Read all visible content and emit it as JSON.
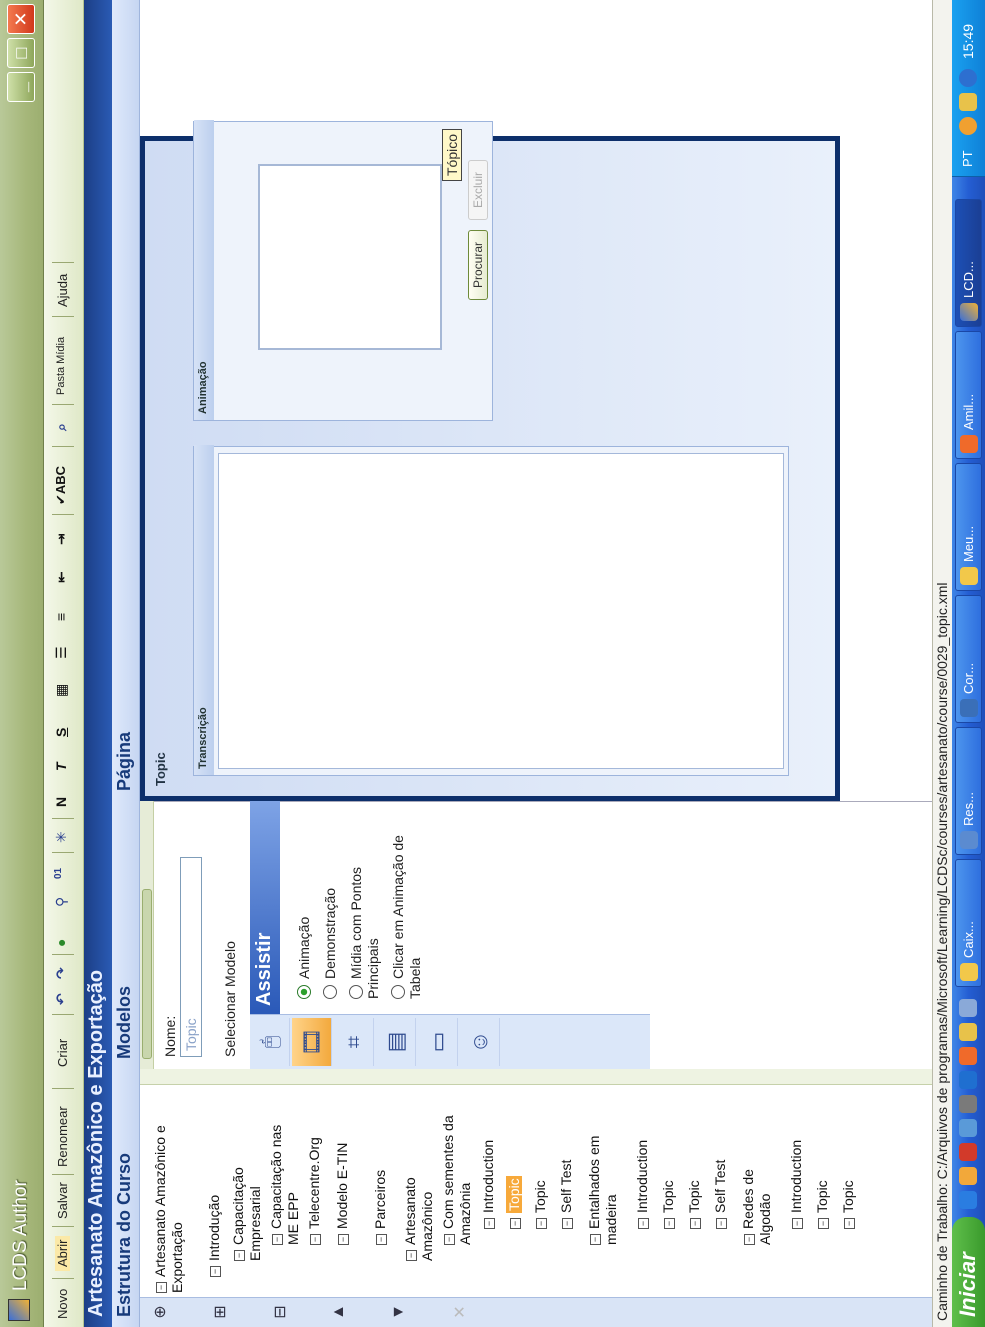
{
  "window": {
    "title": "LCDS Author"
  },
  "toolbar": {
    "novo": "Novo",
    "abrir": "Abrir",
    "salvar": "Salvar",
    "renomear": "Renomear",
    "criar": "Criar",
    "pasta_midia": "Pasta Mídia",
    "ajuda": "Ajuda",
    "bold": "N",
    "italic": "T",
    "underline": "S",
    "spell": "✔ABC"
  },
  "course": {
    "title": "Artesanato Amazônico e Exportação"
  },
  "left_panel": {
    "title": "Estrutura do Curso",
    "tree": [
      "Artesanato Amazônico e Exportação",
      "Introdução",
      "Capacitação Empresarial",
      "Capacitação nas ME EPP",
      "Telecentre.Org",
      "Modelo E-TIN",
      "Parceiros",
      "Artesanato Amazônico",
      "Com sementes da Amazônia",
      "Introduction",
      "Topic",
      "Topic",
      "Self Test",
      "Entalhados em madeira",
      "Introduction",
      "Topic",
      "Topic",
      "Self Test",
      "Redes de Algodão",
      "Introduction",
      "Topic",
      "Topic"
    ]
  },
  "models_panel": {
    "title": "Modelos",
    "nome_label": "Nome:",
    "nome_value": "Topic",
    "select_label": "Selecionar Modelo",
    "assistir": "Assistir",
    "options": [
      "Animação",
      "Demonstração",
      "Mídia com Pontos Principais",
      "Clicar em Animação de Tabela"
    ]
  },
  "page_panel": {
    "title": "Página",
    "topic": "Topic",
    "transcricao": "Transcrição",
    "animacao": "Animação",
    "procurar": "Procurar",
    "excluir": "Excluir",
    "topico_tag": "Tópico"
  },
  "status": {
    "path": "Caminho de Trabalho: C:/Arquivos de programas/Microsoft/Learning/LCDSc/courses/artesanato/course/0029_topic.xml"
  },
  "taskbar": {
    "start": "Iniciar",
    "tasks": [
      "Caix...",
      "Res...",
      "Cor...",
      "Meu...",
      "Amil...",
      "LCD..."
    ],
    "lang": "PT",
    "clock": "15:49"
  },
  "colors": {
    "title_bar": "#a6b77a",
    "course_bar": "#1c3e86",
    "frame": "#0d2f6b",
    "selected": "#f7a93a"
  }
}
